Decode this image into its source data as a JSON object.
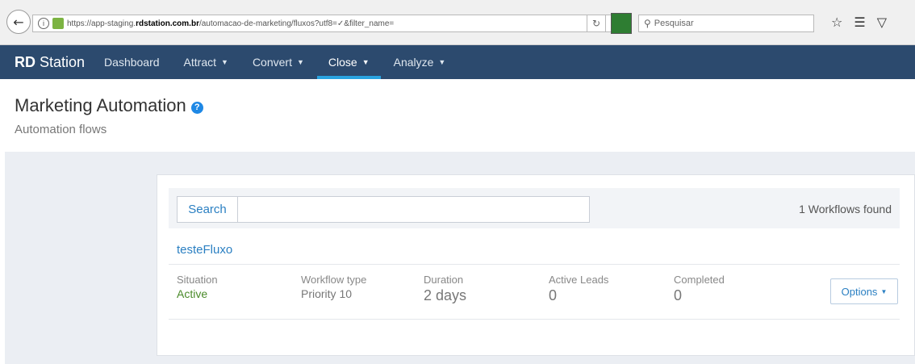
{
  "browser": {
    "url_prefix": "https://app-staging.",
    "url_domain": "rdstation.com.br",
    "url_suffix": "/automacao-de-marketing/fluxos?utf8=✓&filter_name=",
    "search_placeholder": "Pesquisar"
  },
  "nav": {
    "brand_bold": "RD",
    "brand_rest": " Station",
    "items": [
      {
        "label": "Dashboard"
      },
      {
        "label": "Attract"
      },
      {
        "label": "Convert"
      },
      {
        "label": "Close"
      },
      {
        "label": "Analyze"
      }
    ],
    "active_item": "Close"
  },
  "page": {
    "title": "Marketing Automation",
    "subtitle": "Automation flows"
  },
  "search": {
    "button_label": "Search",
    "value": "",
    "found_text": "1 Workflows found"
  },
  "workflow": {
    "name": "testeFluxo",
    "fields": [
      {
        "label": "Situation",
        "value": "Active"
      },
      {
        "label": "Workflow type",
        "value": "Priority 10"
      },
      {
        "label": "Duration",
        "value": "2 days"
      },
      {
        "label": "Active Leads",
        "value": "0"
      },
      {
        "label": "Completed",
        "value": "0"
      }
    ],
    "options_label": "Options"
  },
  "colors": {
    "nav_bg": "#2c4a6e",
    "accent": "#29a3e0",
    "link": "#2a7fc2",
    "active_status": "#4a8a2a"
  }
}
